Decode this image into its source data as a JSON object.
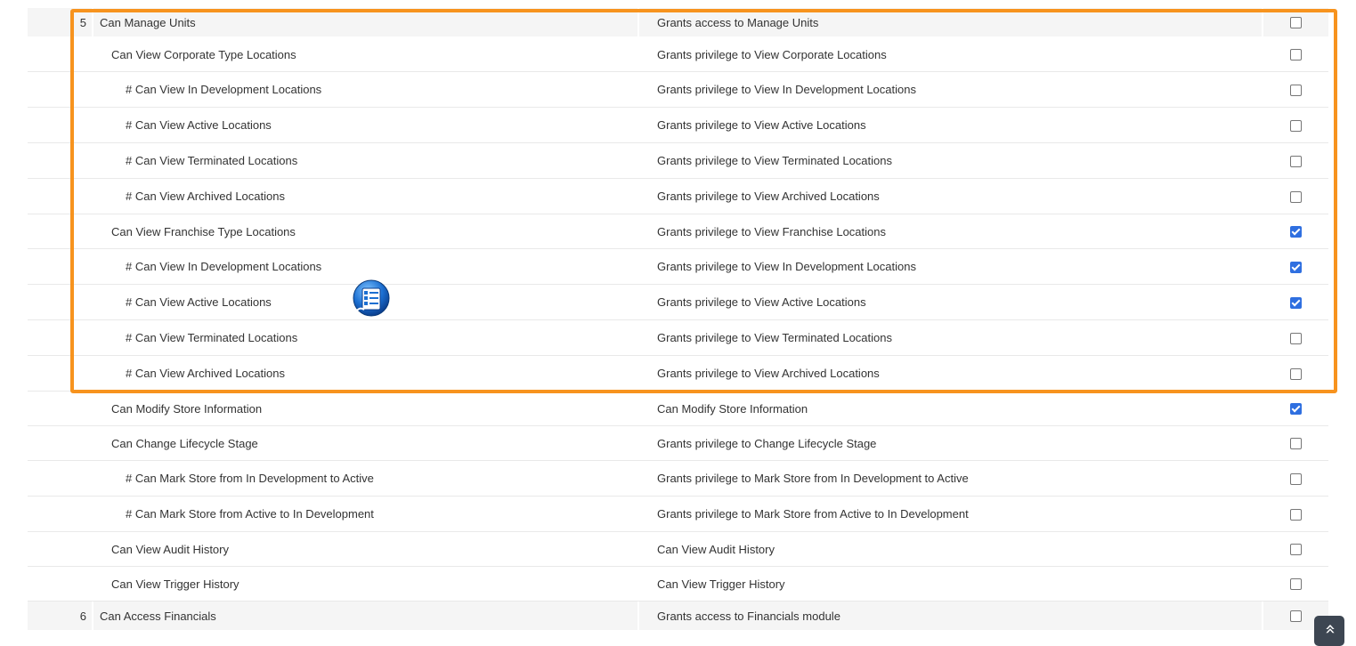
{
  "rows": [
    {
      "kind": "group",
      "num": "5",
      "name": "Can Manage Units",
      "desc": "Grants access to Manage Units",
      "checked": false,
      "indent": 0
    },
    {
      "kind": "item",
      "num": "",
      "name": "Can View Corporate Type Locations",
      "desc": "Grants privilege to View Corporate Locations",
      "checked": false,
      "indent": 1
    },
    {
      "kind": "item",
      "num": "",
      "name": "# Can View In Development Locations",
      "desc": "Grants privilege to View In Development Locations",
      "checked": false,
      "indent": 2
    },
    {
      "kind": "item",
      "num": "",
      "name": "# Can View Active Locations",
      "desc": "Grants privilege to View Active Locations",
      "checked": false,
      "indent": 2
    },
    {
      "kind": "item",
      "num": "",
      "name": "# Can View Terminated Locations",
      "desc": "Grants privilege to View Terminated Locations",
      "checked": false,
      "indent": 2
    },
    {
      "kind": "item",
      "num": "",
      "name": "# Can View Archived Locations",
      "desc": "Grants privilege to View Archived Locations",
      "checked": false,
      "indent": 2
    },
    {
      "kind": "item",
      "num": "",
      "name": "Can View Franchise Type Locations",
      "desc": "Grants privilege to View Franchise Locations",
      "checked": true,
      "indent": 1
    },
    {
      "kind": "item",
      "num": "",
      "name": "# Can View In Development Locations",
      "desc": "Grants privilege to View In Development Locations",
      "checked": true,
      "indent": 2
    },
    {
      "kind": "item",
      "num": "",
      "name": "# Can View Active Locations",
      "desc": "Grants privilege to View Active Locations",
      "checked": true,
      "indent": 2
    },
    {
      "kind": "item",
      "num": "",
      "name": "# Can View Terminated Locations",
      "desc": "Grants privilege to View Terminated Locations",
      "checked": false,
      "indent": 2
    },
    {
      "kind": "item",
      "num": "",
      "name": "# Can View Archived Locations",
      "desc": "Grants privilege to View Archived Locations",
      "checked": false,
      "indent": 2
    },
    {
      "kind": "item",
      "num": "",
      "name": "Can Modify Store Information",
      "desc": "Can Modify Store Information",
      "checked": true,
      "indent": 1
    },
    {
      "kind": "item",
      "num": "",
      "name": "Can Change Lifecycle Stage",
      "desc": "Grants privilege to Change Lifecycle Stage",
      "checked": false,
      "indent": 1
    },
    {
      "kind": "item",
      "num": "",
      "name": "# Can Mark Store from In Development to Active",
      "desc": "Grants privilege to Mark Store from In Development to Active",
      "checked": false,
      "indent": 2
    },
    {
      "kind": "item",
      "num": "",
      "name": "# Can Mark Store from Active to In Development",
      "desc": "Grants privilege to Mark Store from Active to In Development",
      "checked": false,
      "indent": 2
    },
    {
      "kind": "item",
      "num": "",
      "name": "Can View Audit History",
      "desc": "Can View Audit History",
      "checked": false,
      "indent": 1
    },
    {
      "kind": "item",
      "num": "",
      "name": "Can View Trigger History",
      "desc": "Can View Trigger History",
      "checked": false,
      "indent": 1
    },
    {
      "kind": "group",
      "num": "6",
      "name": "Can Access Financials",
      "desc": "Grants access to Financials module",
      "checked": false,
      "indent": 0
    }
  ],
  "icons": {
    "list": "list-icon",
    "scroll_top": "scroll-to-top-icon",
    "scroll_top_glyph": "»"
  },
  "colors": {
    "highlight": "#f7931e",
    "checkbox_checked": "#2f6fe0",
    "group_row_bg": "#f5f5f5"
  }
}
